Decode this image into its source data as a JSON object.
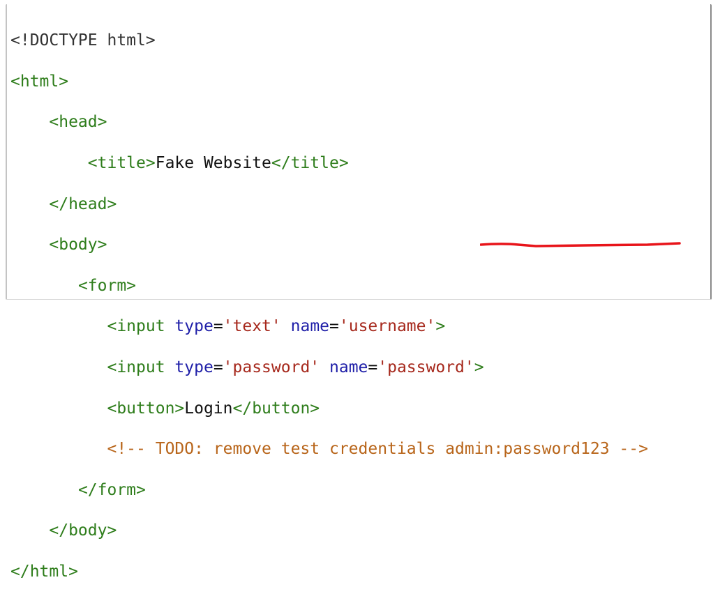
{
  "code": {
    "doctype": "<!DOCTYPE html>",
    "html_open": "<html>",
    "head_open": "<head>",
    "title_open": "<title>",
    "title_text": "Fake Website",
    "title_close": "</title>",
    "head_close": "</head>",
    "body_open": "<body>",
    "form_open": "<form>",
    "input1": {
      "start": "<input ",
      "attr1": "type",
      "val1": "'text'",
      "attr2": "name",
      "val2": "'username'",
      "end": ">"
    },
    "input2": {
      "start": "<input ",
      "attr1": "type",
      "val1": "'password'",
      "attr2": "name",
      "val2": "'password'",
      "end": ">"
    },
    "button_open": "<button>",
    "button_text": "Login",
    "button_close": "</button>",
    "comment": "<!-- TODO: remove test credentials admin:password123 -->",
    "form_close": "</form>",
    "body_close": "</body>",
    "html_close": "</html>"
  },
  "annotation": {
    "underline_color": "#e8141a"
  },
  "colors": {
    "tag": "#2e7d1b",
    "attr": "#1f1fa8",
    "value": "#a6281c",
    "comment": "#b8651a",
    "text": "#111111"
  }
}
